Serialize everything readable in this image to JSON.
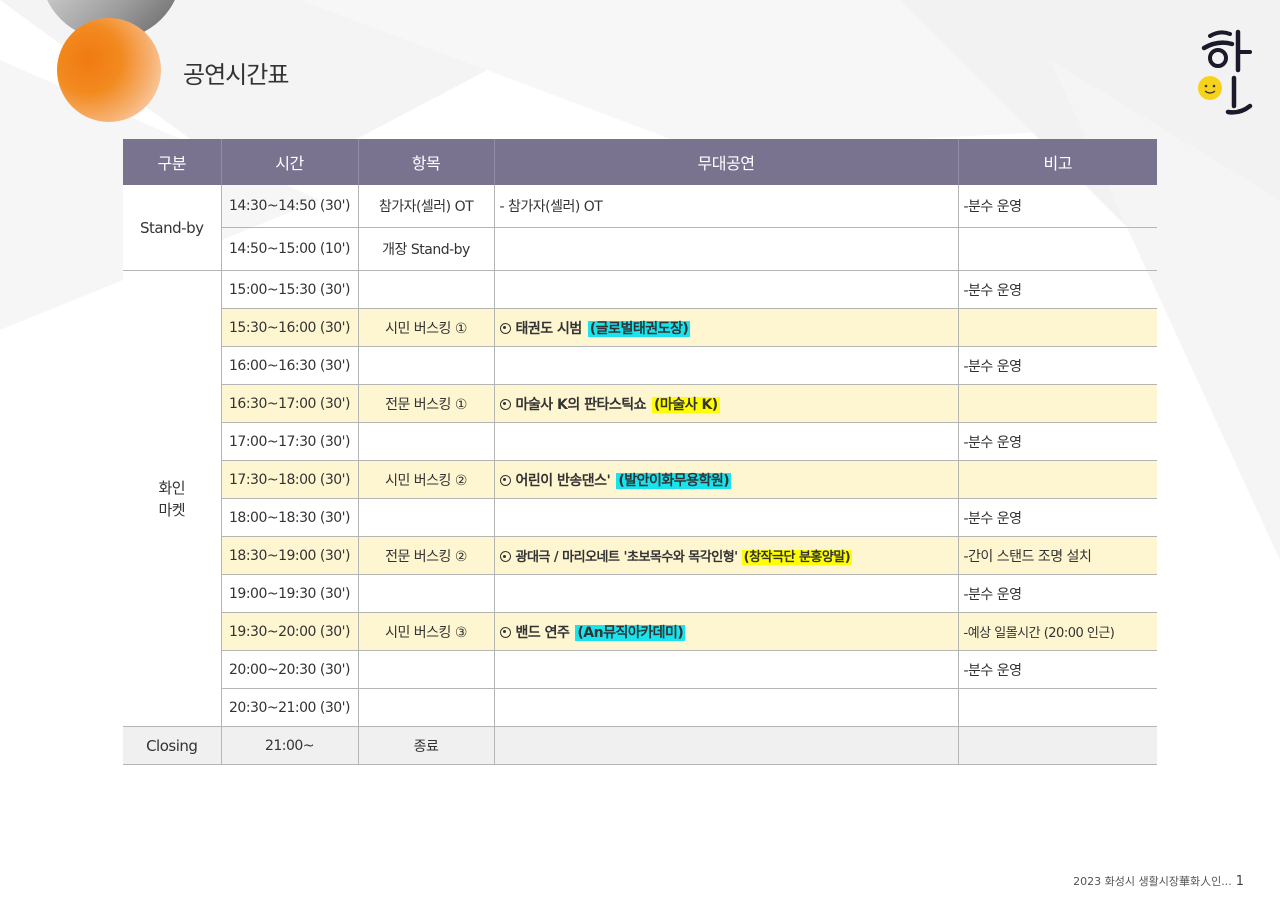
{
  "header": {
    "title": "공연시간표"
  },
  "table": {
    "columns": [
      "구분",
      "시간",
      "항목",
      "무대공연",
      "비고"
    ],
    "groups": [
      "Stand-by",
      "화인\n마켓",
      "Closing"
    ],
    "rows": [
      {
        "time": "14:30~14:50 (30')",
        "item": "참가자(셀러) OT",
        "stage": "- 참가자(셀러) OT",
        "tag": "",
        "note": "-분수 운영"
      },
      {
        "time": "14:50~15:00 (10')",
        "item": "개장 Stand-by",
        "stage": "",
        "tag": "",
        "note": ""
      },
      {
        "time": "15:00~15:30 (30')",
        "item": "",
        "stage": "",
        "tag": "",
        "note": "-분수 운영"
      },
      {
        "time": "15:30~16:00 (30')",
        "item": "시민 버스킹 ①",
        "stage": "태권도 시범",
        "tag": "(글로벌태권도장)",
        "note": ""
      },
      {
        "time": "16:00~16:30 (30')",
        "item": "",
        "stage": "",
        "tag": "",
        "note": "-분수 운영"
      },
      {
        "time": "16:30~17:00 (30')",
        "item": "전문 버스킹 ①",
        "stage": "마술사 K의 판타스틱쇼",
        "tag": "(마술사 K)",
        "note": ""
      },
      {
        "time": "17:00~17:30 (30')",
        "item": "",
        "stage": "",
        "tag": "",
        "note": "-분수 운영"
      },
      {
        "time": "17:30~18:00 (30')",
        "item": "시민 버스킹 ②",
        "stage": "어린이 반송댄스'",
        "tag": "(발안이화무용학원)",
        "note": ""
      },
      {
        "time": "18:00~18:30 (30')",
        "item": "",
        "stage": "",
        "tag": "",
        "note": "-분수 운영"
      },
      {
        "time": "18:30~19:00 (30')",
        "item": "전문 버스킹 ②",
        "stage": "광대극 / 마리오네트 '초보목수와 목각인형'",
        "tag": "(창작극단 분홍양말)",
        "note": "-간이 스탠드 조명 설치"
      },
      {
        "time": "19:00~19:30 (30')",
        "item": "",
        "stage": "",
        "tag": "",
        "note": "-분수 운영"
      },
      {
        "time": "19:30~20:00 (30')",
        "item": "시민 버스킹 ③",
        "stage": "밴드 연주",
        "tag": "(An뮤직아카데미)",
        "note": "-예상 일몰시간 (20:00 인근)"
      },
      {
        "time": "20:00~20:30 (30')",
        "item": "",
        "stage": "",
        "tag": "",
        "note": "-분수 운영"
      },
      {
        "time": "20:30~21:00 (30')",
        "item": "",
        "stage": "",
        "tag": "",
        "note": ""
      },
      {
        "time": "21:00~",
        "item": "종료",
        "stage": "",
        "tag": "",
        "note": ""
      }
    ]
  },
  "footer": {
    "text": "2023 화성시 생활시장華화人인...",
    "page": "1"
  },
  "colors": {
    "header_bg": "#7a7390",
    "highlight_row": "#fef6d1",
    "tag_cyan": "#19e4ee",
    "tag_yellow": "#ffff00",
    "orb": "#f07a10"
  },
  "icons": {
    "performance_marker": "circle-dot-icon",
    "logo": "hwain-logo"
  }
}
